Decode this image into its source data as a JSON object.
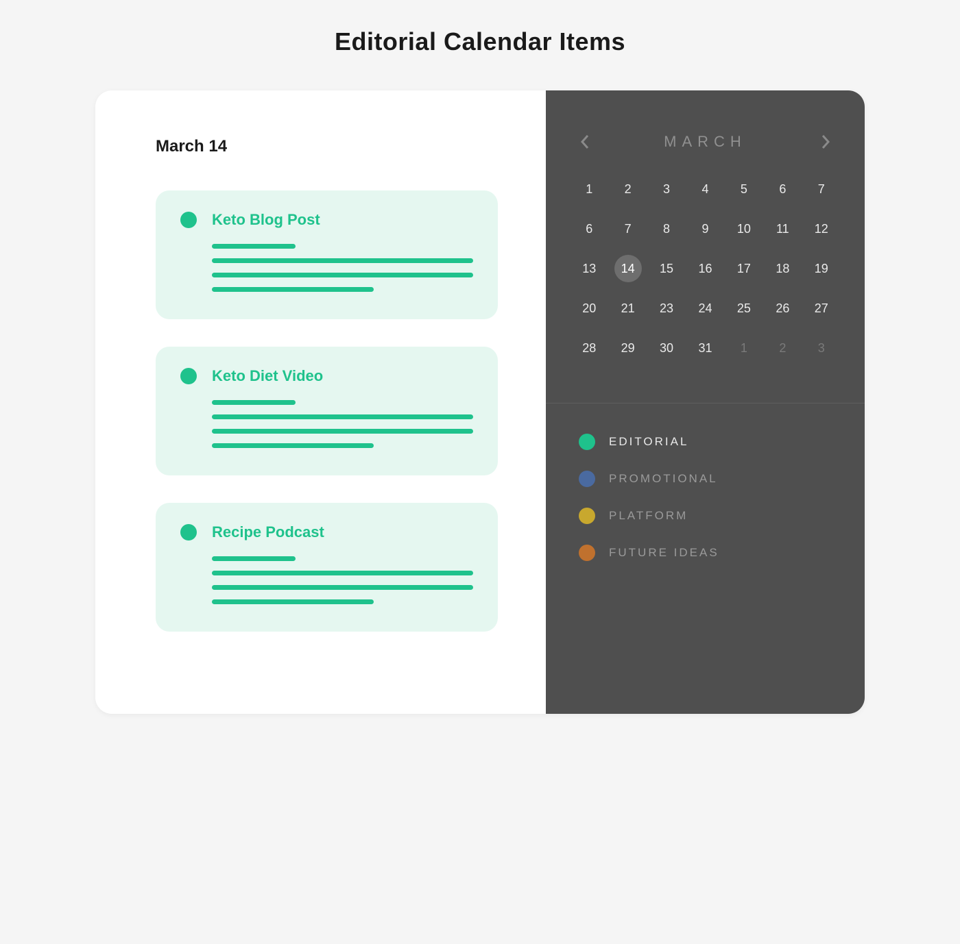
{
  "page_title": "Editorial Calendar Items",
  "selected_date_label": "March 14",
  "items": [
    {
      "title": "Keto Blog Post",
      "color": "#1fc28c"
    },
    {
      "title": "Keto Diet Video",
      "color": "#1fc28c"
    },
    {
      "title": "Recipe Podcast",
      "color": "#1fc28c"
    }
  ],
  "calendar": {
    "month_label": "MARCH",
    "selected_day": 14,
    "days": [
      {
        "n": 1
      },
      {
        "n": 2
      },
      {
        "n": 3
      },
      {
        "n": 4
      },
      {
        "n": 5
      },
      {
        "n": 6
      },
      {
        "n": 7
      },
      {
        "n": 6
      },
      {
        "n": 7
      },
      {
        "n": 8
      },
      {
        "n": 9
      },
      {
        "n": 10
      },
      {
        "n": 11
      },
      {
        "n": 12
      },
      {
        "n": 13
      },
      {
        "n": 14,
        "selected": true
      },
      {
        "n": 15
      },
      {
        "n": 16
      },
      {
        "n": 17
      },
      {
        "n": 18
      },
      {
        "n": 19
      },
      {
        "n": 20
      },
      {
        "n": 21
      },
      {
        "n": 23
      },
      {
        "n": 24
      },
      {
        "n": 25
      },
      {
        "n": 26
      },
      {
        "n": 27
      },
      {
        "n": 28
      },
      {
        "n": 29
      },
      {
        "n": 30
      },
      {
        "n": 31
      },
      {
        "n": 1,
        "other": true
      },
      {
        "n": 2,
        "other": true
      },
      {
        "n": 3,
        "other": true
      }
    ]
  },
  "legend": [
    {
      "label": "EDITORIAL",
      "color": "#1fc28c",
      "active": true
    },
    {
      "label": "PROMOTIONAL",
      "color": "#4a6aa0",
      "active": false
    },
    {
      "label": "PLATFORM",
      "color": "#c8a82e",
      "active": false
    },
    {
      "label": "FUTURE IDEAS",
      "color": "#c0712e",
      "active": false
    }
  ]
}
